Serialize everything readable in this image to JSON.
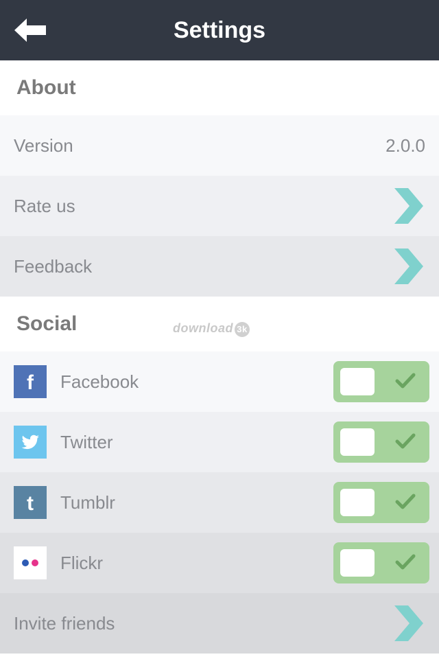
{
  "header": {
    "title": "Settings",
    "back_icon": "arrow-left-icon"
  },
  "about": {
    "title": "About",
    "version_label": "Version",
    "version_value": "2.0.0",
    "rate_label": "Rate us",
    "feedback_label": "Feedback"
  },
  "social": {
    "title": "Social",
    "items": [
      {
        "label": "Facebook",
        "icon": "facebook-icon",
        "enabled": true,
        "icon_color": "#4f73b6"
      },
      {
        "label": "Twitter",
        "icon": "twitter-icon",
        "enabled": true,
        "icon_color": "#6dc5ee"
      },
      {
        "label": "Tumblr",
        "icon": "tumblr-icon",
        "enabled": true,
        "icon_color": "#5983a2"
      },
      {
        "label": "Flickr",
        "icon": "flickr-icon",
        "enabled": true,
        "icon_color": "#ffffff"
      }
    ]
  },
  "invite_label": "Invite friends",
  "watermark": {
    "text": "download",
    "badge": "3k"
  },
  "colors": {
    "header_bg": "#323843",
    "accent_chevron": "#7fd1cd",
    "toggle_on": "#a6d39c",
    "toggle_check": "#6aa460"
  }
}
